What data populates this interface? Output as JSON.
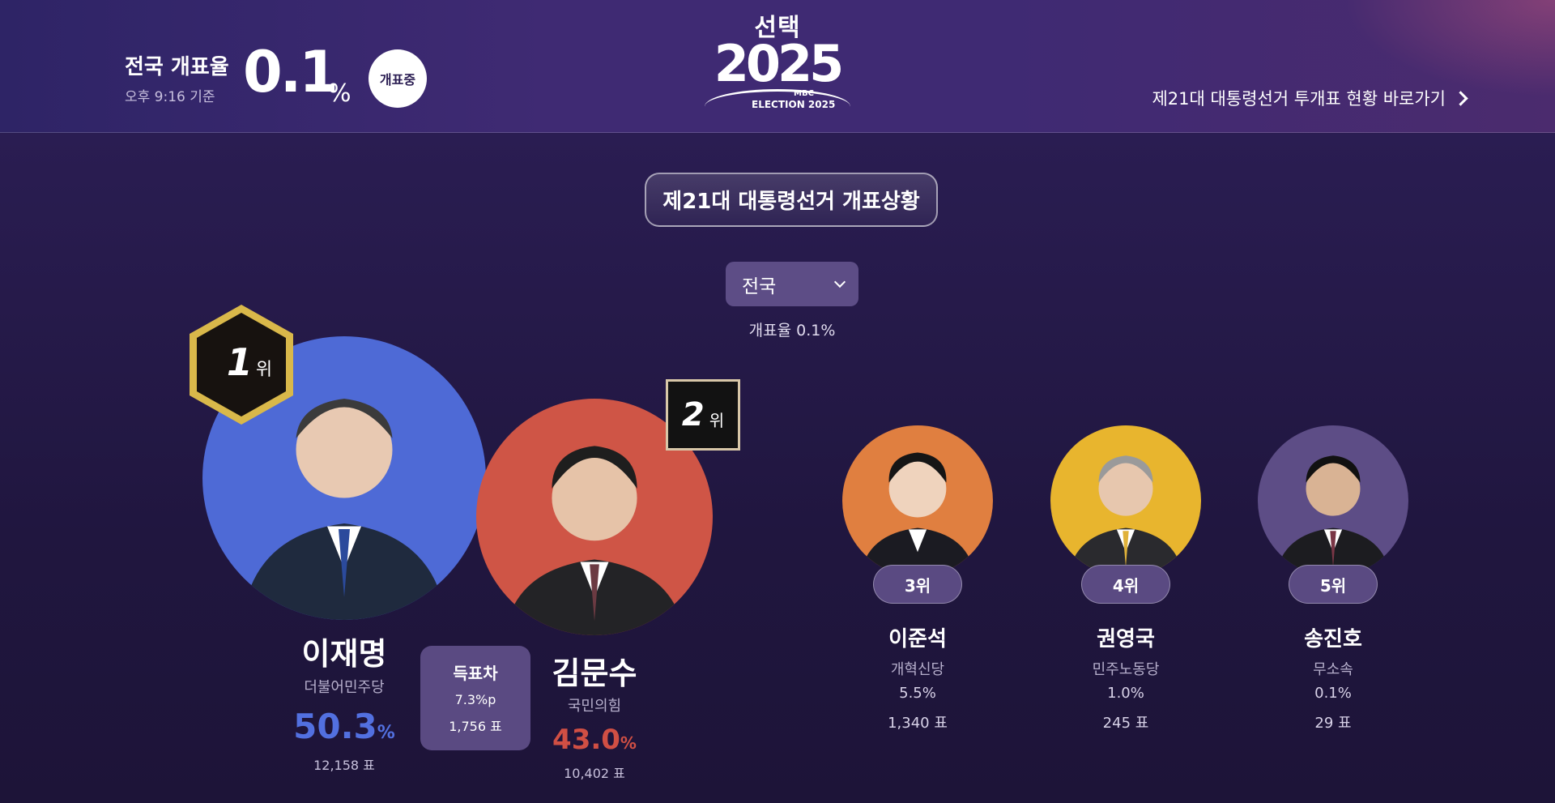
{
  "header": {
    "rate_title": "전국 개표율",
    "rate_time": "오후 9:16 기준",
    "rate_value": "0.1",
    "rate_unit": "%",
    "status_badge": "개표중",
    "logo_top": "선택",
    "logo_year": "2025",
    "logo_mbc": "MBC",
    "logo_sub": "ELECTION 2025",
    "nav_link": "제21대 대통령선거 투개표 현황 바로가기"
  },
  "main": {
    "title": "제21대 대통령선거 개표상황",
    "region_select": {
      "value": "전국"
    },
    "region_rate": "개표율 0.1%"
  },
  "top_candidates": [
    {
      "rank_num": "1",
      "rank_suffix": "위",
      "name": "이재명",
      "party": "더불어민주당",
      "pct": "50.3",
      "pct_unit": "%",
      "votes": "12,158 표",
      "color": "#4e6ad6"
    },
    {
      "rank_num": "2",
      "rank_suffix": "위",
      "name": "김문수",
      "party": "국민의힘",
      "pct": "43.0",
      "pct_unit": "%",
      "votes": "10,402 표",
      "color": "#cf5546"
    }
  ],
  "vote_gap": {
    "title": "득표차",
    "pct": "7.3%p",
    "votes": "1,756 표"
  },
  "other_candidates": [
    {
      "rank": "3위",
      "name": "이준석",
      "party": "개혁신당",
      "pct": "5.5%",
      "votes": "1,340 표",
      "color": "#e07f40"
    },
    {
      "rank": "4위",
      "name": "권영국",
      "party": "민주노동당",
      "pct": "1.0%",
      "votes": "245 표",
      "color": "#e8b52e"
    },
    {
      "rank": "5위",
      "name": "송진호",
      "party": "무소속",
      "pct": "0.1%",
      "votes": "29 표",
      "color": "#5d4d86"
    }
  ]
}
